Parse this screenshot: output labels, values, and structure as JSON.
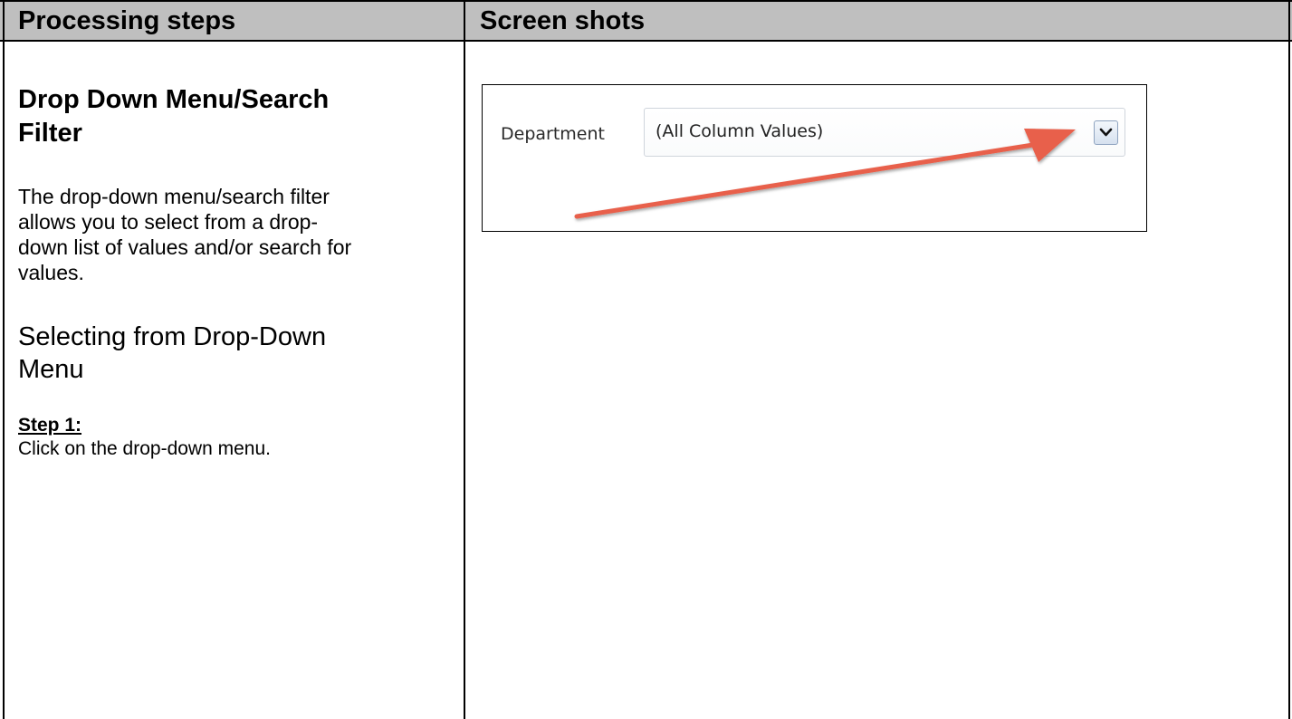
{
  "header": {
    "left_title": "Processing steps",
    "right_title": "Screen shots"
  },
  "content": {
    "section_title_line1": "Drop Down Menu/Search",
    "section_title_line2": "Filter",
    "para_line1": "The drop-down menu/search filter",
    "para_line2": "allows you to select from a drop-",
    "para_line3": "down list of values and/or search for",
    "para_line4": "values.",
    "subhead_line1": "Selecting from Drop-Down",
    "subhead_line2": "Menu",
    "step_label": "Step 1:",
    "step_text": "Click on the drop-down menu."
  },
  "screenshot": {
    "field_label": "Department",
    "dropdown_value": "(All Column Values)",
    "dropdown_icon": "chevron-down-icon",
    "arrow_color": "#e8604c"
  }
}
